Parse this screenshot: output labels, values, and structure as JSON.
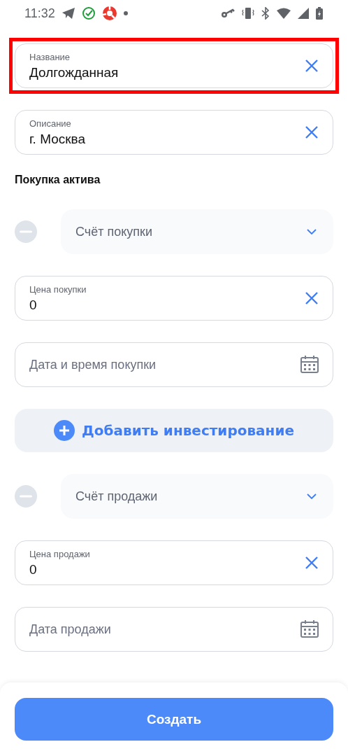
{
  "status_bar": {
    "time": "11:32"
  },
  "items": [
    {
      "kind": "text_field",
      "label": "Название",
      "value": "Долгожданная",
      "highlighted": true
    },
    {
      "kind": "text_field",
      "label": "Описание",
      "value": "г. Москва",
      "highlighted": false
    },
    {
      "kind": "heading",
      "text": "Покупка актива"
    },
    {
      "kind": "select",
      "placeholder": "Счёт покупки"
    },
    {
      "kind": "text_field",
      "label": "Цена покупки",
      "value": "0",
      "highlighted": false
    },
    {
      "kind": "date_field",
      "placeholder": "Дата и время покупки"
    },
    {
      "kind": "add_button",
      "text": "Добавить инвестирование"
    },
    {
      "kind": "select",
      "placeholder": "Счёт продажи"
    },
    {
      "kind": "text_field",
      "label": "Цена продажи",
      "value": "0",
      "highlighted": false
    },
    {
      "kind": "date_field",
      "placeholder": "Дата продажи"
    }
  ],
  "submit_button": "Создать"
}
